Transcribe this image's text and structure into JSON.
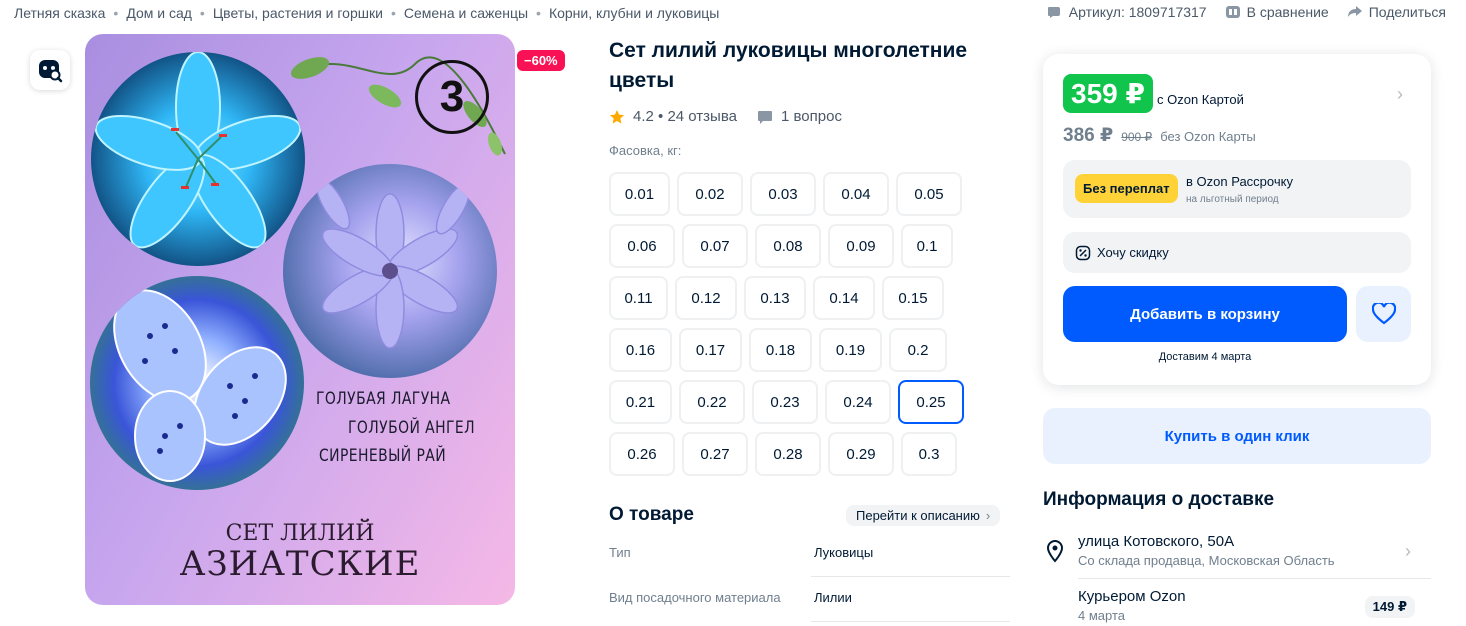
{
  "breadcrumbs": [
    "Летняя сказка",
    "Дом и сад",
    "Цветы, растения и горшки",
    "Семена и саженцы",
    "Корни, клубни и луковицы"
  ],
  "topmeta": {
    "article": "Артикул: 1809717317",
    "compare": "В сравнение",
    "share": "Поделиться"
  },
  "image": {
    "discount": "−60%",
    "count_badge": "3",
    "varieties": [
      "ГОЛУБАЯ ЛАГУНА",
      "ГОЛУБОЙ АНГЕЛ",
      "СИРЕНЕВЫЙ РАЙ"
    ],
    "set_line1": "СЕТ ЛИЛИЙ",
    "set_line2": "АЗИАТСКИЕ"
  },
  "product": {
    "title": "Сет лилий луковицы многолетние цветы",
    "rating": "4.2 • 24 отзыва",
    "questions": "1 вопрос",
    "pack_label": "Фасовка, кг:",
    "options": [
      [
        "0.01",
        "0.02",
        "0.03",
        "0.04",
        "0.05"
      ],
      [
        "0.06",
        "0.07",
        "0.08",
        "0.09",
        "0.1"
      ],
      [
        "0.11",
        "0.12",
        "0.13",
        "0.14",
        "0.15"
      ],
      [
        "0.16",
        "0.17",
        "0.18",
        "0.19",
        "0.2"
      ],
      [
        "0.21",
        "0.22",
        "0.23",
        "0.24",
        "0.25"
      ],
      [
        "0.26",
        "0.27",
        "0.28",
        "0.29",
        "0.3"
      ]
    ],
    "selected_option": "0.25",
    "about_title": "О товаре",
    "goto_description": "Перейти к описанию",
    "specs": [
      {
        "key": "Тип",
        "value": "Луковицы"
      },
      {
        "key": "Вид посадочного материала",
        "value": "Лилии"
      }
    ]
  },
  "buy": {
    "price_card": "359 ₽",
    "price_card_note": "с Ozon Картой",
    "price": "386 ₽",
    "price_old": "900 ₽",
    "price_note": "без Ozon Карты",
    "installment_badge": "Без переплат",
    "installment_title": "в Ozon Рассрочку",
    "installment_sub": "на льготный период",
    "want_discount": "Хочу скидку",
    "add_to_cart": "Добавить в корзину",
    "delivery_date": "Доставим 4 марта",
    "one_click": "Купить в один клик",
    "accent": "#005bff",
    "price_green": "#10c44c"
  },
  "delivery": {
    "title": "Информация о доставке",
    "address": "улица Котовского, 50А",
    "address_sub": "Со склада продавца, Московская Область",
    "courier": "Курьером Ozon",
    "courier_date": "4 марта",
    "courier_price": "149 ₽"
  }
}
